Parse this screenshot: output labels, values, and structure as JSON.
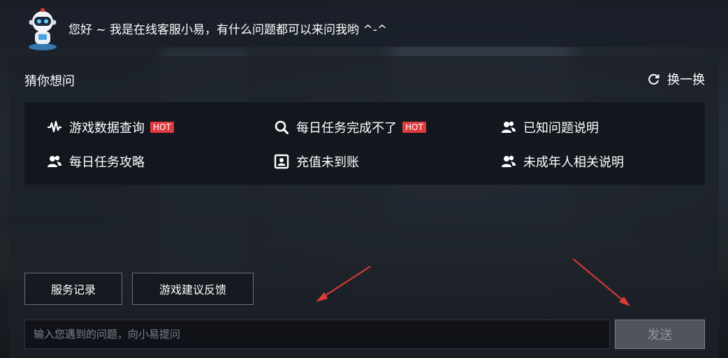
{
  "header": {
    "avatar": "robot-avatar",
    "greeting": "您好 ~ 我是在线客服小易，有什么问题都可以来问我哟 ^-^"
  },
  "suggest": {
    "title": "猜你想问",
    "refresh_label": "换一换",
    "hot_badge": "HOT",
    "items": [
      {
        "label": "游戏数据查询",
        "icon": "pulse-icon",
        "hot": true
      },
      {
        "label": "每日任务完成不了",
        "icon": "search-icon",
        "hot": true
      },
      {
        "label": "已知问题说明",
        "icon": "users-icon",
        "hot": false
      },
      {
        "label": "每日任务攻略",
        "icon": "users-icon",
        "hot": false
      },
      {
        "label": "充值未到账",
        "icon": "portrait-icon",
        "hot": false
      },
      {
        "label": "未成年人相关说明",
        "icon": "users-icon",
        "hot": false
      }
    ]
  },
  "actions": {
    "service_record": "服务记录",
    "feedback": "游戏建议反馈"
  },
  "composer": {
    "placeholder": "输入您遇到的问题，向小易提问",
    "send_label": "发送"
  },
  "colors": {
    "hot": "#e0393e",
    "annotation_arrow": "#e23a36"
  }
}
